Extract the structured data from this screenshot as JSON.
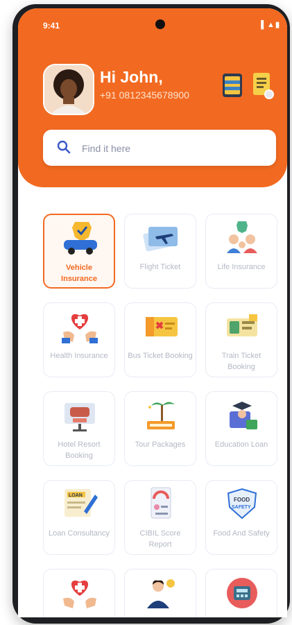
{
  "status_bar": {
    "time": "9:41",
    "indicators": "▌▲▮"
  },
  "header": {
    "greeting": "Hi John,",
    "phone": "+91 0812345678900",
    "icons": [
      "wallet-icon",
      "document-icon"
    ],
    "accent_color": "#f26a21"
  },
  "search": {
    "placeholder": "Find it here",
    "value": ""
  },
  "services": [
    {
      "label": "Vehicle Insurance",
      "icon": "car-shield-icon",
      "selected": true
    },
    {
      "label": "Flight Ticket",
      "icon": "plane-ticket-icon",
      "selected": false
    },
    {
      "label": "Life Insurance",
      "icon": "family-icon",
      "selected": false
    },
    {
      "label": "Health Insurance",
      "icon": "heart-hands-icon",
      "selected": false
    },
    {
      "label": "Bus Ticket Booking",
      "icon": "bus-ticket-icon",
      "selected": false
    },
    {
      "label": "Train Ticket Booking",
      "icon": "train-ticket-icon",
      "selected": false
    },
    {
      "label": "Hotel Resort Booking",
      "icon": "hotel-icon",
      "selected": false
    },
    {
      "label": "Tour Packages",
      "icon": "resort-icon",
      "selected": false
    },
    {
      "label": "Education Loan",
      "icon": "education-icon",
      "selected": false
    },
    {
      "label": "Loan Consultancy",
      "icon": "loan-icon",
      "selected": false
    },
    {
      "label": "CIBIL Score Report",
      "icon": "score-report-icon",
      "selected": false
    },
    {
      "label": "Food And Safety",
      "icon": "food-safety-icon",
      "selected": false
    },
    {
      "label": "",
      "icon": "heart-hands-icon",
      "selected": false
    },
    {
      "label": "",
      "icon": "consultant-icon",
      "selected": false
    },
    {
      "label": "",
      "icon": "calculator-icon",
      "selected": false
    }
  ]
}
